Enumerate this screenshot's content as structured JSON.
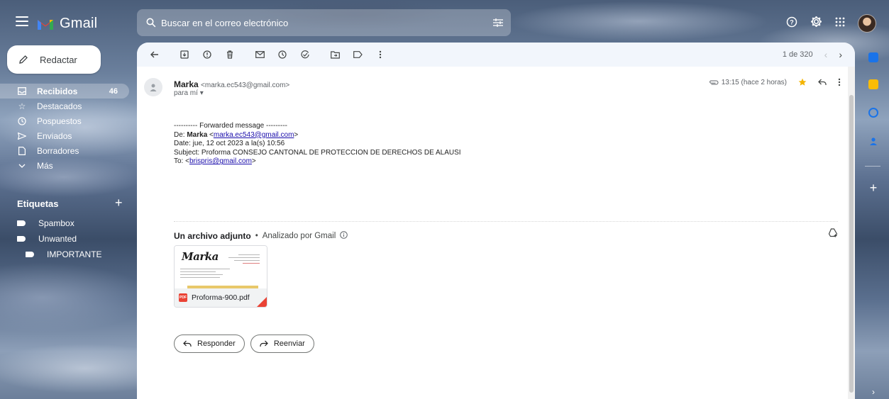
{
  "app": {
    "name": "Gmail"
  },
  "colors": {
    "accent_red": "#ea4335",
    "accent_yellow": "#fbbc04",
    "accent_blue": "#1a73e8",
    "star": "#f4b400"
  },
  "search": {
    "placeholder": "Buscar en el correo electrónico"
  },
  "compose": {
    "label": "Redactar"
  },
  "nav": [
    {
      "label": "Recibidos",
      "count": "46",
      "icon": "inbox-icon"
    },
    {
      "label": "Destacados",
      "icon": "star-icon"
    },
    {
      "label": "Pospuestos",
      "icon": "clock-icon"
    },
    {
      "label": "Enviados",
      "icon": "send-icon"
    },
    {
      "label": "Borradores",
      "icon": "draft-icon"
    },
    {
      "label": "Más",
      "icon": "chevron-down-icon"
    }
  ],
  "labels": {
    "title": "Etiquetas",
    "items": [
      {
        "label": "Spambox"
      },
      {
        "label": "Unwanted"
      },
      {
        "label": "IMPORTANTE"
      }
    ]
  },
  "pager": {
    "text": "1 de 320"
  },
  "message": {
    "sender_name": "Marka",
    "sender_email": "<marka.ec543@gmail.com>",
    "to": "para mí",
    "time": "13:15 (hace 2 horas)",
    "body": {
      "forwarded": "---------- Forwarded message ---------",
      "from_prefix": "De: ",
      "from_name": "Marka",
      "from_email": "marka.ec543@gmail.com",
      "date": "Date: jue, 12 oct 2023 a la(s) 10:56",
      "subject": "Subject: Proforma CONSEJO CANTONAL DE PROTECCION DE DERECHOS DE ALAUSI",
      "to_prefix": "To: ",
      "to_email": "brispris@gmail.com"
    }
  },
  "attachments": {
    "title": "Un archivo adjunto",
    "scanned": "Analizado por Gmail",
    "file": {
      "name": "Proforma-900.pdf",
      "badge": "PDF",
      "thumb_logo": "Marka"
    }
  },
  "actions": {
    "reply": "Responder",
    "forward": "Reenviar"
  }
}
